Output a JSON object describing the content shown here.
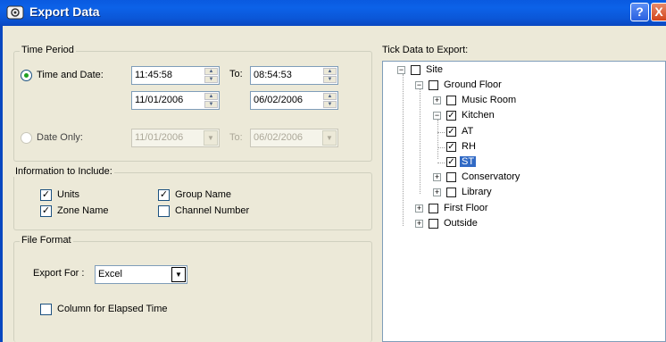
{
  "window": {
    "title": "Export Data",
    "help_glyph": "?",
    "close_glyph": "X"
  },
  "time_period": {
    "group_label": "Time Period",
    "time_and_date": {
      "label": "Time and Date:",
      "selected": true,
      "start_time": "11:45:58",
      "to_label": "To:",
      "end_time": "08:54:53",
      "start_date": "11/01/2006",
      "end_date": "06/02/2006"
    },
    "date_only": {
      "label": "Date Only:",
      "selected": false,
      "start_date": "11/01/2006",
      "to_label": "To:",
      "end_date": "06/02/2006"
    }
  },
  "information": {
    "group_label": "Information to Include:",
    "items": [
      {
        "label": "Units",
        "checked": true
      },
      {
        "label": "Zone Name",
        "checked": true
      },
      {
        "label": "Group Name",
        "checked": true
      },
      {
        "label": "Channel Number",
        "checked": false
      }
    ]
  },
  "file_format": {
    "group_label": "File Format",
    "export_for_label": "Export For :",
    "export_for_value": "Excel",
    "elapsed_label": "Column for Elapsed Time",
    "elapsed_checked": false
  },
  "tree": {
    "label": "Tick Data to Export:",
    "nodes": [
      {
        "label": "Site",
        "checked": false,
        "expander": "−"
      },
      {
        "label": "Ground Floor",
        "checked": false,
        "expander": "−"
      },
      {
        "label": "Music Room",
        "checked": false,
        "expander": "+"
      },
      {
        "label": "Kitchen",
        "checked": true,
        "expander": "−"
      },
      {
        "label": "AT",
        "checked": true
      },
      {
        "label": "RH",
        "checked": true
      },
      {
        "label": "ST",
        "checked": true,
        "selected": true
      },
      {
        "label": "Conservatory",
        "checked": false,
        "expander": "+"
      },
      {
        "label": "Library",
        "checked": false,
        "expander": "+"
      },
      {
        "label": "First Floor",
        "checked": false,
        "expander": "+"
      },
      {
        "label": "Outside",
        "checked": false,
        "expander": "+"
      }
    ]
  },
  "glyphs": {
    "check": "✓",
    "spin_up": "▲",
    "spin_down": "▼",
    "dropdown": "▼"
  },
  "colors": {
    "titlebar": "#0a5ae0",
    "dialog": "#ece9d8",
    "selection": "#316ac5"
  }
}
